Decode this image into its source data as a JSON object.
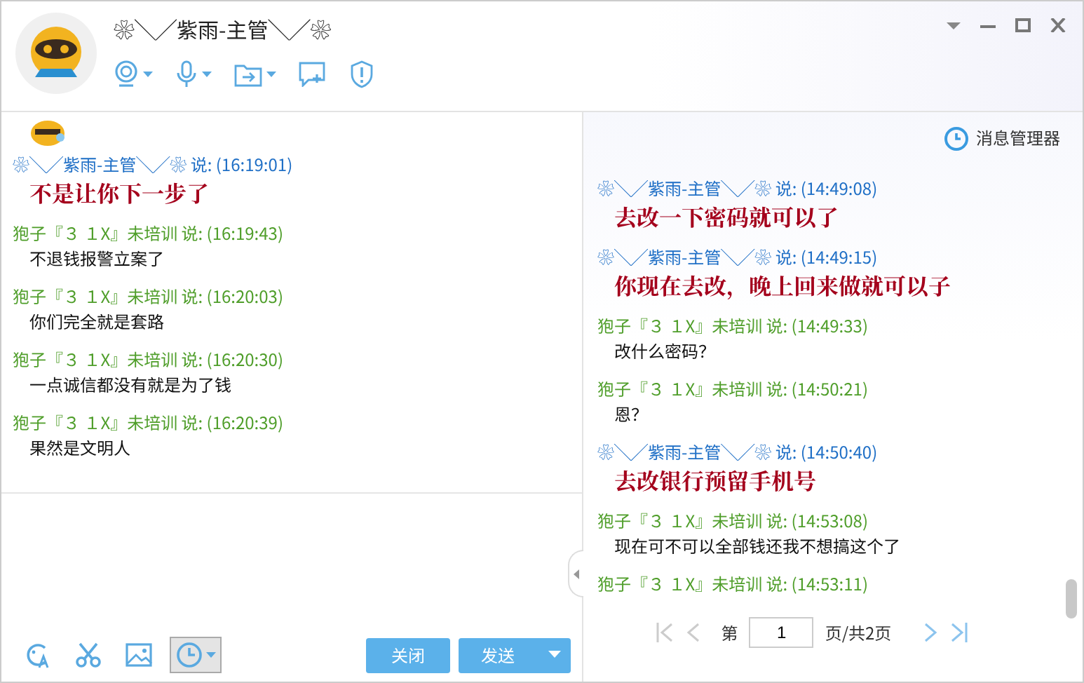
{
  "window": {
    "title": "❀╲╱紫雨-主管╲╱❀"
  },
  "left_chat": {
    "messages": [
      {
        "kind": "manager",
        "header": "❀╲╱紫雨-主管╲╱❀ 说: (16:19:01)",
        "text": "不是让你下一步了"
      },
      {
        "kind": "user",
        "header": "狍子『３ １X』未培训 说: (16:19:43)",
        "text": "不退钱报警立案了"
      },
      {
        "kind": "user",
        "header": "狍子『３ １X』未培训 说: (16:20:03)",
        "text": "你们完全就是套路"
      },
      {
        "kind": "user",
        "header": "狍子『３ １X』未培训 说: (16:20:30)",
        "text": "一点诚信都没有就是为了钱"
      },
      {
        "kind": "user",
        "header": "狍子『３ １X』未培训 说: (16:20:39)",
        "text": "果然是文明人"
      }
    ]
  },
  "input_toolbar": {
    "history_on": true
  },
  "buttons": {
    "close": "关闭",
    "send": "发送"
  },
  "history": {
    "title": "消息管理器",
    "messages": [
      {
        "kind": "manager",
        "header": "❀╲╱紫雨-主管╲╱❀ 说: (14:49:08)",
        "text": "去改一下密码就可以了"
      },
      {
        "kind": "manager",
        "header": "❀╲╱紫雨-主管╲╱❀ 说: (14:49:15)",
        "text": "你现在去改，晚上回来做就可以子"
      },
      {
        "kind": "user",
        "header": "狍子『３ １X』未培训 说: (14:49:33)",
        "text": "改什么密码？"
      },
      {
        "kind": "user",
        "header": "狍子『３ １X』未培训 说: (14:50:21)",
        "text": "恩？"
      },
      {
        "kind": "manager",
        "header": "❀╲╱紫雨-主管╲╱❀ 说: (14:50:40)",
        "text": "去改银行预留手机号"
      },
      {
        "kind": "user",
        "header": "狍子『３ １X』未培训 说: (14:53:08)",
        "text": "现在可不可以全部钱还我不想搞这个了"
      },
      {
        "kind": "user",
        "header": "狍子『３ １X』未培训 说: (14:53:11)"
      }
    ]
  },
  "pager": {
    "prefix": "第",
    "page": "1",
    "suffix": "页/共2页"
  }
}
